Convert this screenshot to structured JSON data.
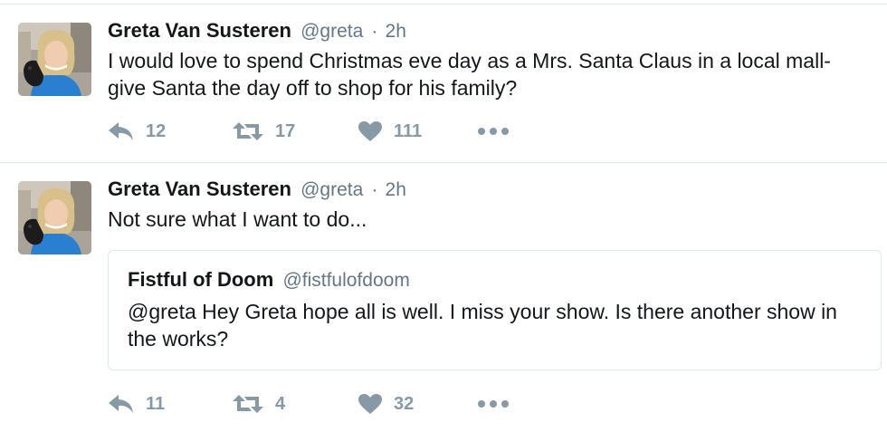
{
  "colors": {
    "text": "#14171a",
    "secondary": "#657786",
    "action_icon": "#8899a6",
    "divider": "#e1e8ed"
  },
  "tweets": [
    {
      "author_name": "Greta Van Susteren",
      "handle": "@greta",
      "separator": "·",
      "time": "2h",
      "text": "I would love to spend Christmas eve day as a Mrs. Santa Claus in a local mall- give Santa the day off to shop for his family?",
      "actions": {
        "reply_icon": "reply-icon",
        "reply_count": "12",
        "retweet_icon": "retweet-icon",
        "retweet_count": "17",
        "like_icon": "heart-icon",
        "like_count": "111",
        "more_icon": "more-dots-icon"
      }
    },
    {
      "author_name": "Greta Van Susteren",
      "handle": "@greta",
      "separator": "·",
      "time": "2h",
      "text": "Not sure what I want to do...",
      "quoted": {
        "author_name": "Fistful of Doom",
        "handle": "@fistfulofdoom",
        "text": "@greta Hey Greta hope all is well. I miss your show. Is there another show in the works?"
      },
      "actions": {
        "reply_icon": "reply-icon",
        "reply_count": "11",
        "retweet_icon": "retweet-icon",
        "retweet_count": "4",
        "like_icon": "heart-icon",
        "like_count": "32",
        "more_icon": "more-dots-icon"
      }
    }
  ]
}
